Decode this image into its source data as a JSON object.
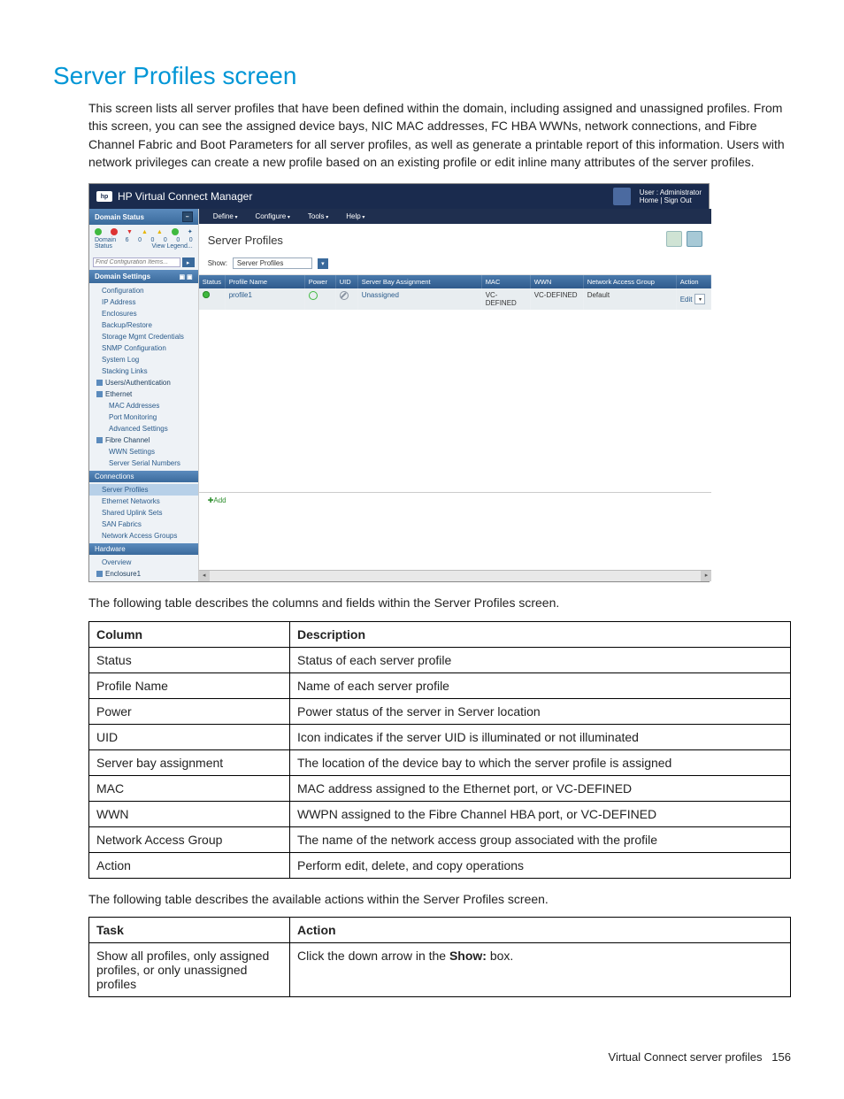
{
  "page": {
    "title": "Server Profiles screen",
    "intro": "This screen lists all server profiles that have been defined within the domain, including assigned and unassigned profiles. From this screen, you can see the assigned device bays, NIC MAC addresses, FC HBA WWNs, network connections, and Fibre Channel Fabric and Boot Parameters for all server profiles, as well as generate a printable report of this information. Users with network privileges can create a new profile based on an existing profile or edit inline many attributes of the server profiles.",
    "para1": "The following table describes the columns and fields within the Server Profiles screen.",
    "para2": "The following table describes the available actions within the Server Profiles screen."
  },
  "screenshot": {
    "app_title": "HP Virtual Connect Manager",
    "user_label": "User : Administrator",
    "home_signout": "Home  |  Sign Out",
    "sidebar": {
      "domain_status_label": "Domain Status",
      "domain_label": "Domain",
      "status_label": "Status",
      "view_legend": "View Legend...",
      "search_placeholder": "Find Configuration Items...",
      "counts": [
        "6",
        "0",
        "0",
        "0",
        "0",
        "0"
      ],
      "sections": {
        "domain_settings": {
          "label": "Domain Settings",
          "items": [
            "Configuration",
            "IP Address",
            "Enclosures",
            "Backup/Restore",
            "Storage Mgmt Credentials",
            "SNMP Configuration",
            "System Log",
            "Stacking Links"
          ]
        },
        "users_auth": "Users/Authentication",
        "ethernet": {
          "label": "Ethernet",
          "items": [
            "MAC Addresses",
            "Port Monitoring",
            "Advanced Settings"
          ]
        },
        "fibre": {
          "label": "Fibre Channel",
          "items": [
            "WWN Settings",
            "Server Serial Numbers"
          ]
        },
        "connections": {
          "label": "Connections",
          "items": [
            "Server Profiles",
            "Ethernet Networks",
            "Shared Uplink Sets",
            "SAN Fabrics",
            "Network Access Groups"
          ]
        },
        "hardware": {
          "label": "Hardware",
          "items": [
            "Overview"
          ],
          "cat_items": [
            "Enclosure1"
          ]
        }
      }
    },
    "menu": [
      "Define",
      "Configure",
      "Tools",
      "Help"
    ],
    "main_title": "Server Profiles",
    "filter_label": "Show:",
    "filter_value": "Server Profiles",
    "grid_headers": {
      "status": "Status",
      "profile_name": "Profile Name",
      "power": "Power",
      "uid": "UID",
      "bay": "Server Bay Assignment",
      "mac": "MAC",
      "wwn": "WWN",
      "nag": "Network Access Group",
      "action": "Action"
    },
    "grid_rows": [
      {
        "profile_name": "profile1",
        "bay": "Unassigned",
        "mac": "VC-DEFINED",
        "wwn": "VC-DEFINED",
        "nag": "Default",
        "action_label": "Edit"
      }
    ],
    "add_label": "Add"
  },
  "columns_table": {
    "headers": [
      "Column",
      "Description"
    ],
    "rows": [
      [
        "Status",
        "Status of each server profile"
      ],
      [
        "Profile Name",
        "Name of each server profile"
      ],
      [
        "Power",
        "Power status of the server in Server location"
      ],
      [
        "UID",
        "Icon indicates if the server UID is illuminated or not illuminated"
      ],
      [
        "Server bay assignment",
        "The location of the device bay to which the server profile is assigned"
      ],
      [
        "MAC",
        "MAC address assigned to the Ethernet port, or VC-DEFINED"
      ],
      [
        "WWN",
        "WWPN assigned to the Fibre Channel HBA port, or VC-DEFINED"
      ],
      [
        "Network Access Group",
        "The name of the network access group associated with the profile"
      ],
      [
        "Action",
        "Perform edit, delete, and copy operations"
      ]
    ]
  },
  "tasks_table": {
    "headers": [
      "Task",
      "Action"
    ],
    "rows": [
      {
        "task": "Show all profiles, only assigned profiles, or only unassigned profiles",
        "action_pre": "Click the down arrow in the ",
        "action_bold": "Show:",
        "action_post": " box."
      }
    ]
  },
  "footer": {
    "text": "Virtual Connect server profiles",
    "page_num": "156"
  }
}
